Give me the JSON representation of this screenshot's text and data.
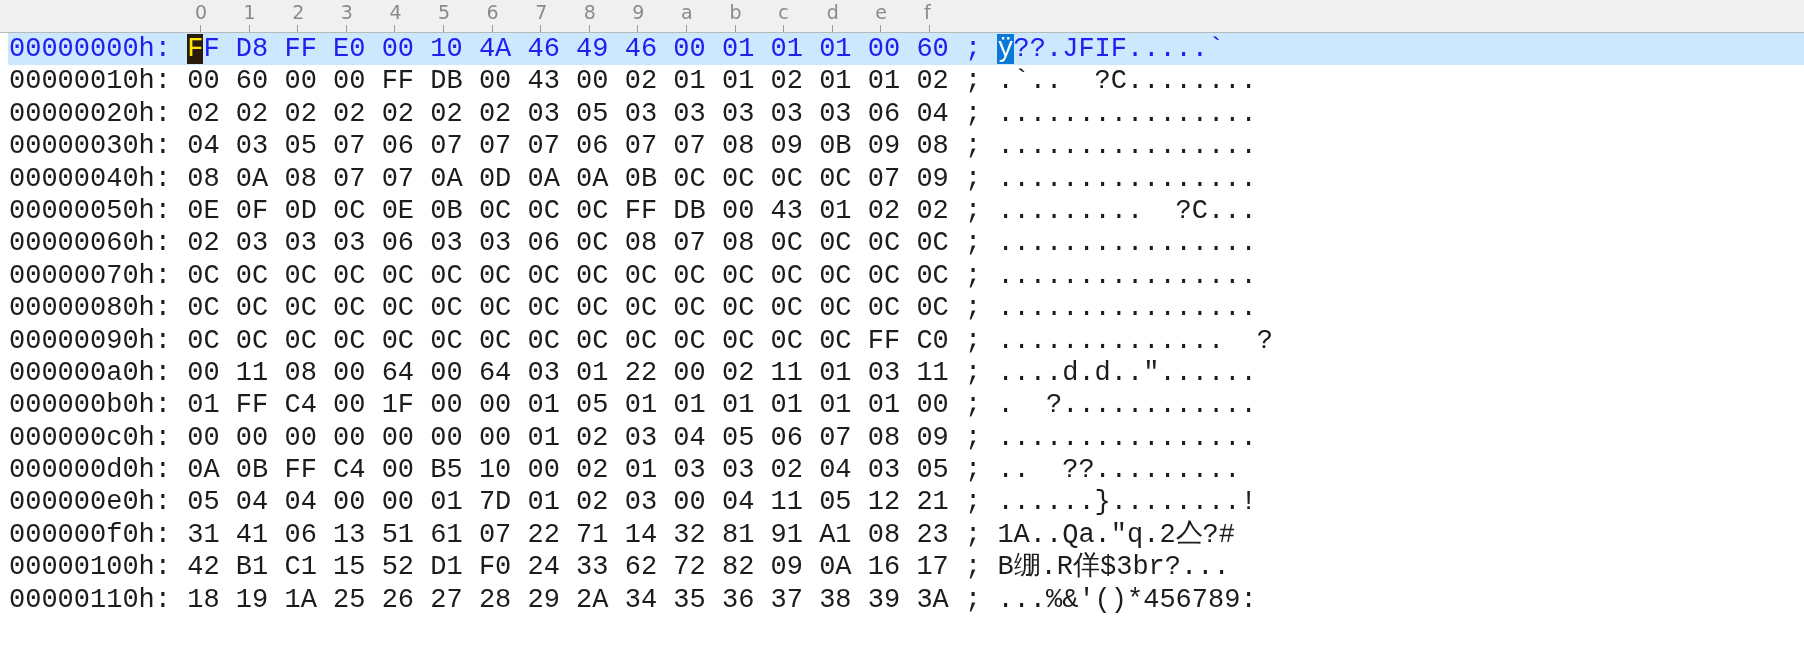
{
  "ruler": [
    "0",
    "1",
    "2",
    "3",
    "4",
    "5",
    "6",
    "7",
    "8",
    "9",
    "a",
    "b",
    "c",
    "d",
    "e",
    "f"
  ],
  "rows": [
    {
      "offset": "00000000h:",
      "bytes": [
        "FF",
        "D8",
        "FF",
        "E0",
        "00",
        "10",
        "4A",
        "46",
        "49",
        "46",
        "00",
        "01",
        "01",
        "01",
        "00",
        "60"
      ],
      "separator": ";",
      "ascii": "ÿ??.JFIF.....`",
      "selected": true,
      "cursor": true
    },
    {
      "offset": "00000010h:",
      "bytes": [
        "00",
        "60",
        "00",
        "00",
        "FF",
        "DB",
        "00",
        "43",
        "00",
        "02",
        "01",
        "01",
        "02",
        "01",
        "01",
        "02"
      ],
      "separator": ";",
      "ascii": ".`..  ?C........",
      "selected": false,
      "cursor": false
    },
    {
      "offset": "00000020h:",
      "bytes": [
        "02",
        "02",
        "02",
        "02",
        "02",
        "02",
        "02",
        "03",
        "05",
        "03",
        "03",
        "03",
        "03",
        "03",
        "06",
        "04"
      ],
      "separator": ";",
      "ascii": "................",
      "selected": false,
      "cursor": false
    },
    {
      "offset": "00000030h:",
      "bytes": [
        "04",
        "03",
        "05",
        "07",
        "06",
        "07",
        "07",
        "07",
        "06",
        "07",
        "07",
        "08",
        "09",
        "0B",
        "09",
        "08"
      ],
      "separator": ";",
      "ascii": "................",
      "selected": false,
      "cursor": false
    },
    {
      "offset": "00000040h:",
      "bytes": [
        "08",
        "0A",
        "08",
        "07",
        "07",
        "0A",
        "0D",
        "0A",
        "0A",
        "0B",
        "0C",
        "0C",
        "0C",
        "0C",
        "07",
        "09"
      ],
      "separator": ";",
      "ascii": "................",
      "selected": false,
      "cursor": false
    },
    {
      "offset": "00000050h:",
      "bytes": [
        "0E",
        "0F",
        "0D",
        "0C",
        "0E",
        "0B",
        "0C",
        "0C",
        "0C",
        "FF",
        "DB",
        "00",
        "43",
        "01",
        "02",
        "02"
      ],
      "separator": ";",
      "ascii": ".........  ?C...",
      "selected": false,
      "cursor": false
    },
    {
      "offset": "00000060h:",
      "bytes": [
        "02",
        "03",
        "03",
        "03",
        "06",
        "03",
        "03",
        "06",
        "0C",
        "08",
        "07",
        "08",
        "0C",
        "0C",
        "0C",
        "0C"
      ],
      "separator": ";",
      "ascii": "................",
      "selected": false,
      "cursor": false
    },
    {
      "offset": "00000070h:",
      "bytes": [
        "0C",
        "0C",
        "0C",
        "0C",
        "0C",
        "0C",
        "0C",
        "0C",
        "0C",
        "0C",
        "0C",
        "0C",
        "0C",
        "0C",
        "0C",
        "0C"
      ],
      "separator": ";",
      "ascii": "................",
      "selected": false,
      "cursor": false
    },
    {
      "offset": "00000080h:",
      "bytes": [
        "0C",
        "0C",
        "0C",
        "0C",
        "0C",
        "0C",
        "0C",
        "0C",
        "0C",
        "0C",
        "0C",
        "0C",
        "0C",
        "0C",
        "0C",
        "0C"
      ],
      "separator": ";",
      "ascii": "................",
      "selected": false,
      "cursor": false
    },
    {
      "offset": "00000090h:",
      "bytes": [
        "0C",
        "0C",
        "0C",
        "0C",
        "0C",
        "0C",
        "0C",
        "0C",
        "0C",
        "0C",
        "0C",
        "0C",
        "0C",
        "0C",
        "FF",
        "C0"
      ],
      "separator": ";",
      "ascii": "..............  ?",
      "selected": false,
      "cursor": false
    },
    {
      "offset": "000000a0h:",
      "bytes": [
        "00",
        "11",
        "08",
        "00",
        "64",
        "00",
        "64",
        "03",
        "01",
        "22",
        "00",
        "02",
        "11",
        "01",
        "03",
        "11"
      ],
      "separator": ";",
      "ascii": "....d.d..\"......",
      "selected": false,
      "cursor": false
    },
    {
      "offset": "000000b0h:",
      "bytes": [
        "01",
        "FF",
        "C4",
        "00",
        "1F",
        "00",
        "00",
        "01",
        "05",
        "01",
        "01",
        "01",
        "01",
        "01",
        "01",
        "00"
      ],
      "separator": ";",
      "ascii": ".  ?............",
      "selected": false,
      "cursor": false
    },
    {
      "offset": "000000c0h:",
      "bytes": [
        "00",
        "00",
        "00",
        "00",
        "00",
        "00",
        "00",
        "01",
        "02",
        "03",
        "04",
        "05",
        "06",
        "07",
        "08",
        "09"
      ],
      "separator": ";",
      "ascii": "................",
      "selected": false,
      "cursor": false
    },
    {
      "offset": "000000d0h:",
      "bytes": [
        "0A",
        "0B",
        "FF",
        "C4",
        "00",
        "B5",
        "10",
        "00",
        "02",
        "01",
        "03",
        "03",
        "02",
        "04",
        "03",
        "05"
      ],
      "separator": ";",
      "ascii": "..  ??.........",
      "selected": false,
      "cursor": false
    },
    {
      "offset": "000000e0h:",
      "bytes": [
        "05",
        "04",
        "04",
        "00",
        "00",
        "01",
        "7D",
        "01",
        "02",
        "03",
        "00",
        "04",
        "11",
        "05",
        "12",
        "21"
      ],
      "separator": ";",
      "ascii": "......}........!",
      "selected": false,
      "cursor": false
    },
    {
      "offset": "000000f0h:",
      "bytes": [
        "31",
        "41",
        "06",
        "13",
        "51",
        "61",
        "07",
        "22",
        "71",
        "14",
        "32",
        "81",
        "91",
        "A1",
        "08",
        "23"
      ],
      "separator": ";",
      "ascii": "1A..Qa.\"q.2亼?#",
      "selected": false,
      "cursor": false
    },
    {
      "offset": "00000100h:",
      "bytes": [
        "42",
        "B1",
        "C1",
        "15",
        "52",
        "D1",
        "F0",
        "24",
        "33",
        "62",
        "72",
        "82",
        "09",
        "0A",
        "16",
        "17"
      ],
      "separator": ";",
      "ascii": "B绷.R佯$3br?...",
      "selected": false,
      "cursor": false
    },
    {
      "offset": "00000110h:",
      "bytes": [
        "18",
        "19",
        "1A",
        "25",
        "26",
        "27",
        "28",
        "29",
        "2A",
        "34",
        "35",
        "36",
        "37",
        "38",
        "39",
        "3A"
      ],
      "separator": ";",
      "ascii": "...%&'()*456789:",
      "selected": false,
      "cursor": false
    }
  ]
}
